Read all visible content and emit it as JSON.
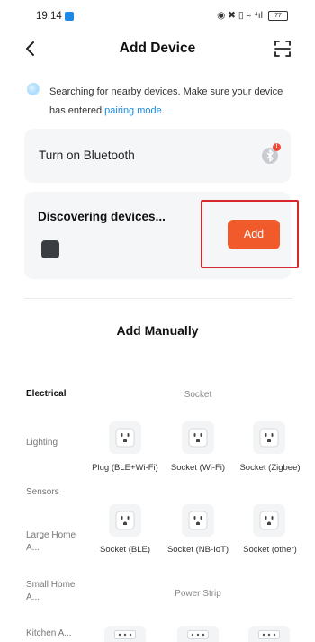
{
  "status_bar": {
    "time": "19:14",
    "icons": "◉ ✖ ▯ ≈ ⁴ıl",
    "battery": "77"
  },
  "header": {
    "title": "Add Device",
    "back_icon": "chevron-left-icon",
    "scan_icon": "scan-icon"
  },
  "search": {
    "text": "Searching for nearby devices. Make sure your device has entered ",
    "link": "pairing mode",
    "suffix": "."
  },
  "bluetooth": {
    "label": "Turn on Bluetooth",
    "badge": "!"
  },
  "discovering": {
    "label": "Discovering devices...",
    "add_label": "Add",
    "accent": "#f15a2b",
    "highlight_color": "#d7262c"
  },
  "manual": {
    "title": "Add Manually"
  },
  "categories": [
    {
      "label": "Electrical"
    },
    {
      "label": "Lighting"
    },
    {
      "label": "Sensors"
    },
    {
      "label": "Large Home A..."
    },
    {
      "label": "Small Home A..."
    },
    {
      "label": "Kitchen A..."
    }
  ],
  "groups": {
    "socket": "Socket",
    "power_strip": "Power Strip"
  },
  "devices": [
    {
      "label": "Plug (BLE+Wi-Fi)"
    },
    {
      "label": "Socket (Wi-Fi)"
    },
    {
      "label": "Socket (Zigbee)"
    },
    {
      "label": "Socket (BLE)"
    },
    {
      "label": "Socket (NB-IoT)"
    },
    {
      "label": "Socket (other)"
    }
  ]
}
